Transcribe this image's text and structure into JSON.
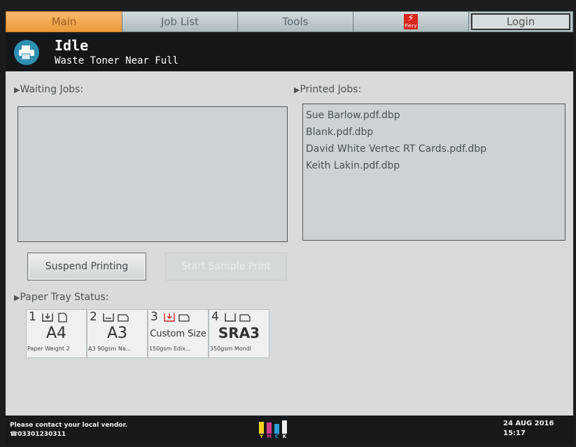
{
  "tabs": [
    {
      "label": "Main"
    },
    {
      "label": "Job List"
    },
    {
      "label": "Tools"
    },
    {
      "label": "Fiery",
      "icon": "fiery-logo-icon"
    },
    {
      "label": "Login"
    }
  ],
  "status": {
    "title": "Idle",
    "subtitle": "Waste Toner Near Full",
    "icon": "printer-icon"
  },
  "waiting_jobs": {
    "label": "Waiting Jobs:",
    "items": []
  },
  "printed_jobs": {
    "label": "Printed Jobs:",
    "items": [
      "Sue Barlow.pdf.dbp",
      "Blank.pdf.dbp",
      "David White Vertec RT Cards.pdf.dbp",
      "Keith Lakin.pdf.dbp"
    ]
  },
  "buttons": {
    "suspend": "Suspend Printing",
    "sample": "Start Sample Print"
  },
  "paper_tray": {
    "label": "Paper Tray Status:",
    "trays": [
      {
        "number": "1",
        "size": "A4",
        "desc": "Paper Weight 2"
      },
      {
        "number": "2",
        "size": "A3",
        "desc": "A3 90gsm Na..."
      },
      {
        "number": "3",
        "size": "Custom Size",
        "desc": "150gsm Edix..."
      },
      {
        "number": "4",
        "size": "SRA3",
        "desc": "350gsm Mondi"
      }
    ]
  },
  "footer": {
    "vendor": "Please contact your local vendor.",
    "phone": "☎03301230311",
    "date": "24 AUG  2016",
    "time": "15:17",
    "toner": [
      {
        "color": "Y",
        "hex": "#f4d21c",
        "level": 0.85
      },
      {
        "color": "M",
        "hex": "#d63a8c",
        "level": 0.8
      },
      {
        "color": "C",
        "hex": "#2a9fd6",
        "level": 0.7
      },
      {
        "color": "K",
        "hex": "#f0f0f0",
        "level": 0.95
      }
    ]
  },
  "colors": {
    "active_tab": "#ec9a3a",
    "status_bar": "#13171a",
    "panel": "#d7dbdd"
  }
}
